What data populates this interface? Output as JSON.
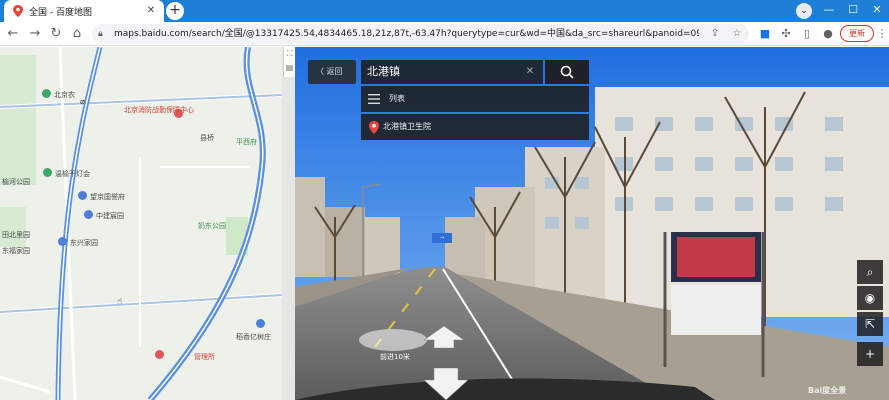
{
  "browser": {
    "tab": {
      "title": "全国 - 百度地图"
    },
    "new_tab_label": "+",
    "address": {
      "url": "maps.baidu.com/search/全国/@13317425.54,4834465.18,21z,87t,-63.47h?querytype=cur&wd=中国&da_src=shareurl&panoid=090022..."
    },
    "update_label": "更新"
  },
  "search": {
    "back_label": "返回",
    "query": "北港镇",
    "list_label": "列表",
    "result_label": "北港镇卫生院"
  },
  "streetview": {
    "walk_label": "前进10米",
    "watermark": "Bai度全景"
  },
  "map": {
    "labels": [
      "北京消防战勤保障中心",
      "平西府",
      "温榆干灯会",
      "望京国誉府",
      "中建宸园",
      "东兴家园",
      "奶东公园",
      "稻香亿树庄",
      "管理所",
      "北京农",
      "榆河公园",
      "田北里园",
      "东福家园",
      "县桥"
    ]
  },
  "icons": {
    "tab_favicon": "map-pin-icon",
    "back": "arrow-left-icon",
    "forward": "arrow-right-icon",
    "reload": "reload-icon",
    "home": "home-icon",
    "lock": "lock-icon",
    "search": "search-icon",
    "list": "list-icon",
    "result_pin": "location-pin-icon"
  },
  "colors": {
    "tabbar": "#1e7fd6",
    "highway": "#5b8fe0",
    "update_red": "#d93025"
  }
}
